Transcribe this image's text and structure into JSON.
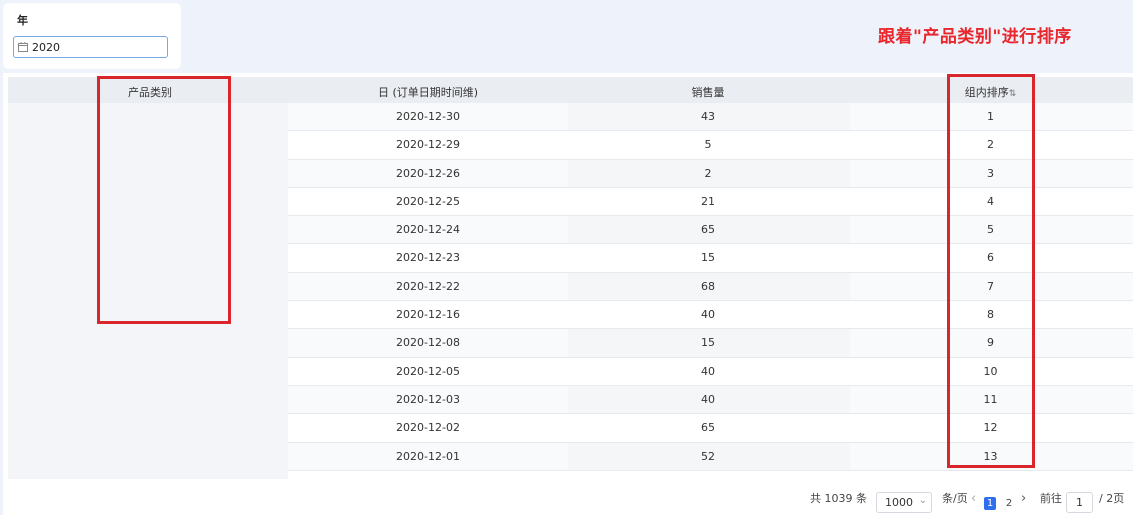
{
  "filter": {
    "title": "年",
    "value": "2020"
  },
  "annotation": "跟着\"产品类别\"进行排序",
  "table": {
    "headers": {
      "category": "产品类别",
      "date": "日 (订单日期时间维)",
      "quantity": "销售量",
      "rank": "组内排序",
      "rank_sort_icon": "⇅"
    },
    "rows": [
      {
        "date": "2020-12-30",
        "quantity": "43",
        "rank": "1"
      },
      {
        "date": "2020-12-29",
        "quantity": "5",
        "rank": "2"
      },
      {
        "date": "2020-12-26",
        "quantity": "2",
        "rank": "3"
      },
      {
        "date": "2020-12-25",
        "quantity": "21",
        "rank": "4"
      },
      {
        "date": "2020-12-24",
        "quantity": "65",
        "rank": "5"
      },
      {
        "date": "2020-12-23",
        "quantity": "15",
        "rank": "6"
      },
      {
        "date": "2020-12-22",
        "quantity": "68",
        "rank": "7"
      },
      {
        "date": "2020-12-16",
        "quantity": "40",
        "rank": "8"
      },
      {
        "date": "2020-12-08",
        "quantity": "15",
        "rank": "9"
      },
      {
        "date": "2020-12-05",
        "quantity": "40",
        "rank": "10"
      },
      {
        "date": "2020-12-03",
        "quantity": "40",
        "rank": "11"
      },
      {
        "date": "2020-12-02",
        "quantity": "65",
        "rank": "12"
      },
      {
        "date": "2020-12-01",
        "quantity": "52",
        "rank": "13"
      }
    ]
  },
  "pagination": {
    "total": "共 1039 条",
    "page_size": "1000",
    "per_page_label": "条/页",
    "prev": "‹",
    "pages": [
      "1",
      "2"
    ],
    "next": "›",
    "goto_label": "前往",
    "goto_value": "1",
    "total_pages": "/ 2页"
  },
  "colors": {
    "accent": "#2f6fed",
    "highlight": "#d9262c"
  }
}
